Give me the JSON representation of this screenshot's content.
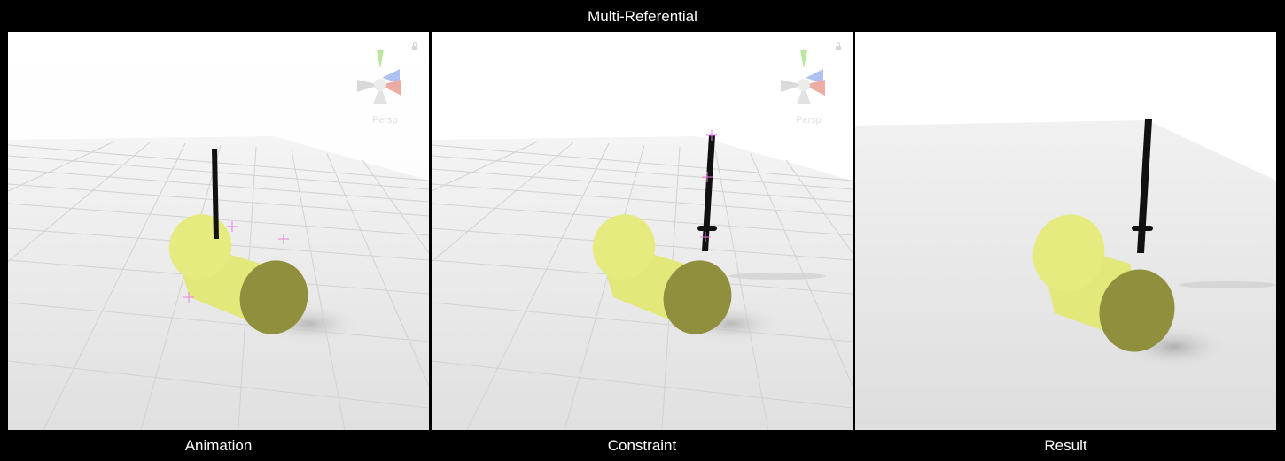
{
  "header": {
    "title": "Multi-Referential"
  },
  "panels": [
    {
      "caption": "Animation",
      "camera_label": "Persp",
      "gizmo": "view-orientation-gizmo-icon",
      "locked": true
    },
    {
      "caption": "Constraint",
      "camera_label": "Persp",
      "gizmo": "view-orientation-gizmo-icon",
      "locked": true
    },
    {
      "caption": "Result"
    }
  ],
  "colors": {
    "background": "#000000",
    "cylinder_body": "#e3e87a",
    "cylinder_cap": "#8f8f3e",
    "stick": "#111111",
    "locator": "#e57fe0",
    "ground": "#e6e6e6",
    "grid": "#cfcfcf"
  }
}
